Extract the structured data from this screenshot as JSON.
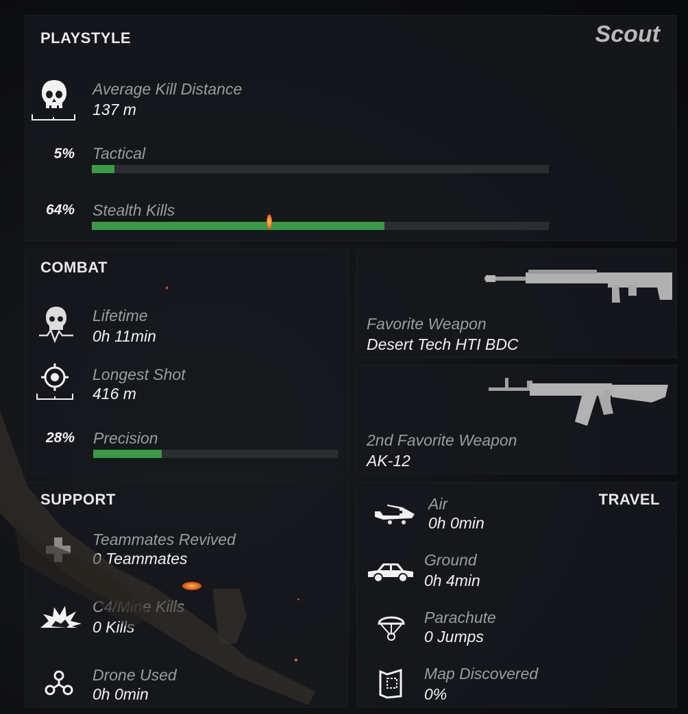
{
  "playstyle": {
    "title": "PLAYSTYLE",
    "class_name": "Scout",
    "avg_kill_distance": {
      "label": "Average Kill Distance",
      "value": "137 m"
    },
    "tactical": {
      "label": "Tactical",
      "percent_text": "5%",
      "percent": 5
    },
    "stealth": {
      "label": "Stealth Kills",
      "percent_text": "64%",
      "percent": 64
    }
  },
  "combat": {
    "title": "COMBAT",
    "lifetime": {
      "label": "Lifetime",
      "value": "0h 11min"
    },
    "longest_shot": {
      "label": "Longest Shot",
      "value": "416 m"
    },
    "precision": {
      "label": "Precision",
      "percent_text": "28%",
      "percent": 28
    }
  },
  "weapons": {
    "favorite": {
      "label": "Favorite Weapon",
      "value": "Desert Tech HTI BDC"
    },
    "second": {
      "label": "2nd Favorite Weapon",
      "value": "AK-12"
    }
  },
  "support": {
    "title": "SUPPORT",
    "revived": {
      "label": "Teammates Revived",
      "value": "0 Teammates"
    },
    "c4": {
      "label": "C4/Mine Kills",
      "value": "0 Kills"
    },
    "drone": {
      "label": "Drone Used",
      "value": "0h 0min"
    }
  },
  "travel": {
    "title": "TRAVEL",
    "air": {
      "label": "Air",
      "value": "0h 0min"
    },
    "ground": {
      "label": "Ground",
      "value": "0h 4min"
    },
    "parachute": {
      "label": "Parachute",
      "value": "0 Jumps"
    },
    "map": {
      "label": "Map Discovered",
      "value": "0%"
    }
  },
  "colors": {
    "bar_fill": "#3a9a46",
    "bar_track": "#2b2d31",
    "label": "#9a9c9f"
  }
}
